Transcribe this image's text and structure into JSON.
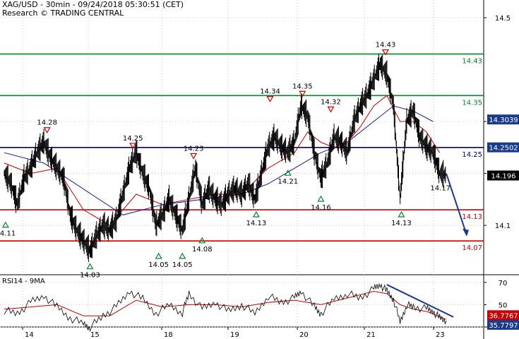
{
  "header": {
    "line1": "XAG/USD - 30min - 09/24/2018 05:30:51 (CET)",
    "line2": "Research © TRADING CENTRAL"
  },
  "rsi_label": "RSI14 - 9MA",
  "colors": {
    "price": "#000000",
    "ma_fast": "#cc0000",
    "ma_slow": "#1a1a99",
    "support": "#cc0000",
    "resistance": "#00882a",
    "pivot": "#000080",
    "arrow": "#1a3a8a",
    "last_price_bg": "#000000",
    "pivot_badge_bg": "#1a3a8a",
    "grid": "#c8c8c8"
  },
  "chart_data": [
    {
      "type": "line",
      "name": "price",
      "ylim": [
        14.0,
        14.5
      ],
      "yticks": [
        "14.5",
        "14.3",
        "14.2",
        "14.1"
      ],
      "xticks": [
        "14",
        "15",
        "18",
        "19",
        "20",
        "21",
        "23"
      ],
      "levels": [
        {
          "value": 14.43,
          "label": "14.43",
          "kind": "resistance"
        },
        {
          "value": 14.35,
          "label": "14.35",
          "kind": "resistance"
        },
        {
          "value": 14.25,
          "label": "14.25",
          "kind": "pivot"
        },
        {
          "value": 14.13,
          "label": "14.13",
          "kind": "support"
        },
        {
          "value": 14.07,
          "label": "14.07",
          "kind": "support"
        }
      ],
      "badges": [
        {
          "value": 14.3039,
          "label": "14.3039",
          "style": "pivot"
        },
        {
          "value": 14.2502,
          "label": "14.2502",
          "style": "pivot"
        },
        {
          "value": 14.196,
          "label": "14.196",
          "style": "last"
        }
      ],
      "annotations": [
        {
          "x": 0.2,
          "y": 14.11,
          "label": "14.11",
          "marker": "low"
        },
        {
          "x": 6.5,
          "y": 14.28,
          "label": "14.28",
          "marker": "high"
        },
        {
          "x": 13.0,
          "y": 14.03,
          "label": "14.03",
          "marker": "low"
        },
        {
          "x": 19.5,
          "y": 14.25,
          "label": "14.25",
          "marker": "high"
        },
        {
          "x": 23.4,
          "y": 14.05,
          "label": "14.05",
          "marker": "low"
        },
        {
          "x": 27.0,
          "y": 14.05,
          "label": "14.05",
          "marker": "low"
        },
        {
          "x": 28.7,
          "y": 14.23,
          "label": "14.23",
          "marker": "high"
        },
        {
          "x": 30.0,
          "y": 14.08,
          "label": "14.08",
          "marker": "low"
        },
        {
          "x": 38.2,
          "y": 14.13,
          "label": "14.13",
          "marker": "low"
        },
        {
          "x": 40.3,
          "y": 14.34,
          "label": "14.34",
          "marker": "high"
        },
        {
          "x": 43.0,
          "y": 14.21,
          "label": "14.21",
          "marker": "low"
        },
        {
          "x": 45.2,
          "y": 14.35,
          "label": "14.35",
          "marker": "high"
        },
        {
          "x": 48.0,
          "y": 14.16,
          "label": "14.16",
          "marker": "low"
        },
        {
          "x": 49.5,
          "y": 14.32,
          "label": "14.32",
          "marker": "high"
        },
        {
          "x": 57.8,
          "y": 14.43,
          "label": "14.43",
          "marker": "high"
        },
        {
          "x": 60.2,
          "y": 14.13,
          "label": "14.13",
          "marker": "low"
        }
      ],
      "price_points": [
        [
          0.0,
          14.2
        ],
        [
          1.0,
          14.18
        ],
        [
          2.0,
          14.14
        ],
        [
          3.0,
          14.19
        ],
        [
          4.0,
          14.21
        ],
        [
          5.0,
          14.24
        ],
        [
          6.0,
          14.26
        ],
        [
          7.0,
          14.23
        ],
        [
          8.0,
          14.21
        ],
        [
          9.0,
          14.19
        ],
        [
          10.0,
          14.12
        ],
        [
          11.0,
          14.09
        ],
        [
          12.0,
          14.07
        ],
        [
          13.0,
          14.05
        ],
        [
          14.0,
          14.08
        ],
        [
          15.0,
          14.1
        ],
        [
          16.0,
          14.09
        ],
        [
          17.0,
          14.11
        ],
        [
          18.0,
          14.16
        ],
        [
          19.0,
          14.21
        ],
        [
          20.0,
          14.24
        ],
        [
          21.0,
          14.2
        ],
        [
          22.0,
          14.17
        ],
        [
          23.0,
          14.1
        ],
        [
          24.0,
          14.12
        ],
        [
          25.0,
          14.15
        ],
        [
          26.0,
          14.12
        ],
        [
          27.0,
          14.09
        ],
        [
          28.0,
          14.15
        ],
        [
          29.0,
          14.21
        ],
        [
          30.0,
          14.14
        ],
        [
          31.0,
          14.17
        ],
        [
          32.0,
          14.15
        ],
        [
          33.0,
          14.14
        ],
        [
          34.0,
          14.16
        ],
        [
          35.0,
          14.17
        ],
        [
          36.0,
          14.16
        ],
        [
          37.0,
          14.18
        ],
        [
          38.0,
          14.15
        ],
        [
          39.0,
          14.2
        ],
        [
          40.0,
          14.25
        ],
        [
          41.0,
          14.27
        ],
        [
          42.0,
          14.25
        ],
        [
          43.0,
          14.24
        ],
        [
          44.0,
          14.26
        ],
        [
          45.0,
          14.33
        ],
        [
          46.0,
          14.31
        ],
        [
          47.0,
          14.24
        ],
        [
          48.0,
          14.19
        ],
        [
          49.0,
          14.22
        ],
        [
          50.0,
          14.27
        ],
        [
          51.0,
          14.26
        ],
        [
          52.0,
          14.24
        ],
        [
          53.0,
          14.3
        ],
        [
          54.0,
          14.33
        ],
        [
          55.0,
          14.35
        ],
        [
          56.0,
          14.38
        ],
        [
          57.0,
          14.41
        ],
        [
          58.0,
          14.39
        ],
        [
          59.0,
          14.33
        ],
        [
          60.0,
          14.15
        ],
        [
          61.0,
          14.3
        ],
        [
          62.0,
          14.32
        ],
        [
          63.0,
          14.27
        ],
        [
          64.0,
          14.25
        ],
        [
          65.0,
          14.24
        ],
        [
          66.0,
          14.2
        ],
        [
          67.0,
          14.196
        ]
      ],
      "ma_fast_points": [
        [
          0.0,
          14.22
        ],
        [
          4.0,
          14.2
        ],
        [
          8.0,
          14.21
        ],
        [
          12.0,
          14.13
        ],
        [
          16.0,
          14.1
        ],
        [
          20.0,
          14.16
        ],
        [
          24.0,
          14.14
        ],
        [
          28.0,
          14.15
        ],
        [
          32.0,
          14.16
        ],
        [
          36.0,
          14.16
        ],
        [
          40.0,
          14.21
        ],
        [
          44.0,
          14.24
        ],
        [
          46.0,
          14.28
        ],
        [
          48.0,
          14.26
        ],
        [
          50.0,
          14.25
        ],
        [
          52.0,
          14.26
        ],
        [
          54.0,
          14.29
        ],
        [
          56.0,
          14.33
        ],
        [
          58.0,
          14.35
        ],
        [
          60.0,
          14.3
        ],
        [
          62.0,
          14.3
        ],
        [
          64.0,
          14.28
        ],
        [
          66.0,
          14.24
        ]
      ],
      "ma_slow_points": [
        [
          0.0,
          14.24
        ],
        [
          6.0,
          14.22
        ],
        [
          12.0,
          14.17
        ],
        [
          18.0,
          14.12
        ],
        [
          24.0,
          14.14
        ],
        [
          30.0,
          14.15
        ],
        [
          36.0,
          14.16
        ],
        [
          40.0,
          14.18
        ],
        [
          44.0,
          14.21
        ],
        [
          48.0,
          14.24
        ],
        [
          52.0,
          14.26
        ],
        [
          56.0,
          14.3
        ],
        [
          59.0,
          14.33
        ],
        [
          62.0,
          14.32
        ],
        [
          65.0,
          14.3
        ]
      ],
      "projection": [
        [
          67.0,
          14.2
        ],
        [
          70.0,
          14.08
        ]
      ]
    },
    {
      "type": "line",
      "name": "RSI14 - 9MA",
      "ylim": [
        30,
        75
      ],
      "yticks": [
        "70",
        "50",
        "30"
      ],
      "badges": [
        {
          "value": 36.7767,
          "label": "36.7767",
          "style": "ma"
        },
        {
          "value": 35.7797,
          "label": "35.7797",
          "style": "rsi"
        }
      ],
      "rsi_points": [
        [
          0,
          45
        ],
        [
          2,
          42
        ],
        [
          4,
          52
        ],
        [
          6,
          58
        ],
        [
          8,
          48
        ],
        [
          10,
          38
        ],
        [
          12,
          33
        ],
        [
          13,
          30
        ],
        [
          15,
          40
        ],
        [
          17,
          48
        ],
        [
          19,
          62
        ],
        [
          21,
          55
        ],
        [
          23,
          42
        ],
        [
          25,
          50
        ],
        [
          27,
          43
        ],
        [
          28,
          60
        ],
        [
          30,
          46
        ],
        [
          32,
          52
        ],
        [
          34,
          44
        ],
        [
          36,
          50
        ],
        [
          38,
          42
        ],
        [
          40,
          58
        ],
        [
          42,
          52
        ],
        [
          44,
          56
        ],
        [
          45,
          62
        ],
        [
          47,
          48
        ],
        [
          48,
          42
        ],
        [
          50,
          55
        ],
        [
          52,
          60
        ],
        [
          54,
          56
        ],
        [
          56,
          64
        ],
        [
          57,
          68
        ],
        [
          58,
          62
        ],
        [
          59,
          55
        ],
        [
          60,
          34
        ],
        [
          61,
          50
        ],
        [
          62,
          48
        ],
        [
          64,
          46
        ],
        [
          65,
          44
        ],
        [
          66,
          38
        ],
        [
          67,
          35.78
        ]
      ],
      "rsi_ma_points": [
        [
          0,
          46
        ],
        [
          4,
          48
        ],
        [
          8,
          50
        ],
        [
          12,
          40
        ],
        [
          16,
          40
        ],
        [
          20,
          54
        ],
        [
          24,
          48
        ],
        [
          28,
          50
        ],
        [
          32,
          50
        ],
        [
          36,
          48
        ],
        [
          40,
          52
        ],
        [
          44,
          54
        ],
        [
          48,
          50
        ],
        [
          52,
          56
        ],
        [
          56,
          62
        ],
        [
          58,
          60
        ],
        [
          60,
          50
        ],
        [
          62,
          46
        ],
        [
          64,
          44
        ],
        [
          67,
          36.78
        ]
      ],
      "trendline": [
        [
          58,
          68
        ],
        [
          70,
          39
        ]
      ]
    }
  ]
}
